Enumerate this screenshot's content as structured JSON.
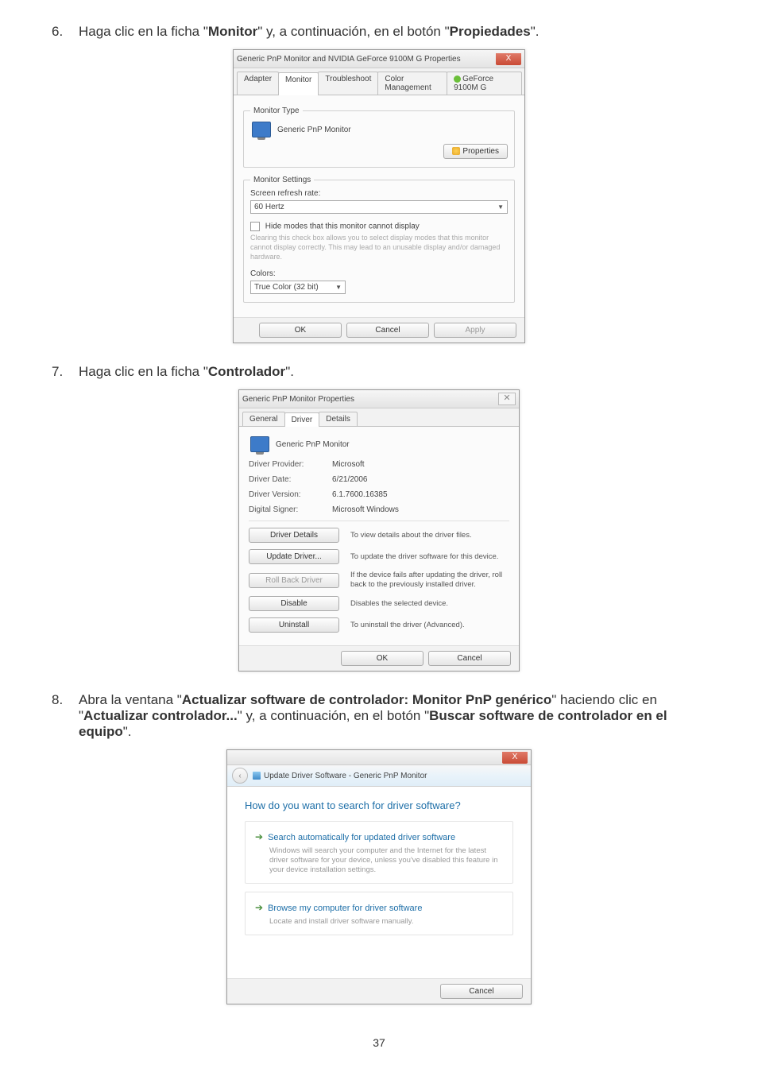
{
  "steps": {
    "s6": {
      "num": "6.",
      "pre": "Haga clic en la ficha \"",
      "b1": "Monitor",
      "mid": "\" y, a continuación, en el botón \"",
      "b2": "Propiedades",
      "post": "\"."
    },
    "s7": {
      "num": "7.",
      "pre": "Haga clic en la ficha \"",
      "b1": "Controlador",
      "post": "\"."
    },
    "s8": {
      "num": "8.",
      "line1_pre": "Abra la ventana \"",
      "line1_b": "Actualizar software de controlador: Monitor PnP genérico",
      "line1_post": "\"",
      "line2_pre": "haciendo clic en \"",
      "line2_b": "Actualizar controlador...",
      "line2_mid": "\" y, a continuación, en el botón \"",
      "line2_b2": "Buscar",
      "line3_b": "software de controlador en el equipo",
      "line3_post": "\"."
    }
  },
  "dlg1": {
    "title": "Generic PnP Monitor and NVIDIA GeForce 9100M G   Properties",
    "tabs": {
      "adapter": "Adapter",
      "monitor": "Monitor",
      "troubleshoot": "Troubleshoot",
      "color": "Color Management",
      "geforce": "GeForce 9100M G"
    },
    "monitor_type_legend": "Monitor Type",
    "monitor_name": "Generic PnP Monitor",
    "properties_btn": "Properties",
    "settings_legend": "Monitor Settings",
    "refresh_label": "Screen refresh rate:",
    "refresh_value": "60 Hertz",
    "hide_modes": "Hide modes that this monitor cannot display",
    "hide_help": "Clearing this check box allows you to select display modes that this monitor cannot display correctly. This may lead to an unusable display and/or damaged hardware.",
    "colors_label": "Colors:",
    "colors_value": "True Color (32 bit)",
    "ok": "OK",
    "cancel": "Cancel",
    "apply": "Apply"
  },
  "dlg2": {
    "title": "Generic PnP Monitor Properties",
    "tabs": {
      "general": "General",
      "driver": "Driver",
      "details": "Details"
    },
    "monitor_name": "Generic PnP Monitor",
    "rows": {
      "provider_l": "Driver Provider:",
      "provider_v": "Microsoft",
      "date_l": "Driver Date:",
      "date_v": "6/21/2006",
      "version_l": "Driver Version:",
      "version_v": "6.1.7600.16385",
      "signer_l": "Digital Signer:",
      "signer_v": "Microsoft Windows"
    },
    "actions": {
      "details_btn": "Driver Details",
      "details_desc": "To view details about the driver files.",
      "update_btn": "Update Driver...",
      "update_desc": "To update the driver software for this device.",
      "rollback_btn": "Roll Back Driver",
      "rollback_desc": "If the device fails after updating the driver, roll back to the previously installed driver.",
      "disable_btn": "Disable",
      "disable_desc": "Disables the selected device.",
      "uninstall_btn": "Uninstall",
      "uninstall_desc": "To uninstall the driver (Advanced)."
    },
    "ok": "OK",
    "cancel": "Cancel"
  },
  "dlg3": {
    "crumb": "Update Driver Software - Generic PnP Monitor",
    "heading": "How do you want to search for driver software?",
    "opt1_title": "Search automatically for updated driver software",
    "opt1_desc": "Windows will search your computer and the Internet for the latest driver software for your device, unless you've disabled this feature in your device installation settings.",
    "opt2_title": "Browse my computer for driver software",
    "opt2_desc": "Locate and install driver software manually.",
    "cancel": "Cancel"
  },
  "page_number": "37"
}
